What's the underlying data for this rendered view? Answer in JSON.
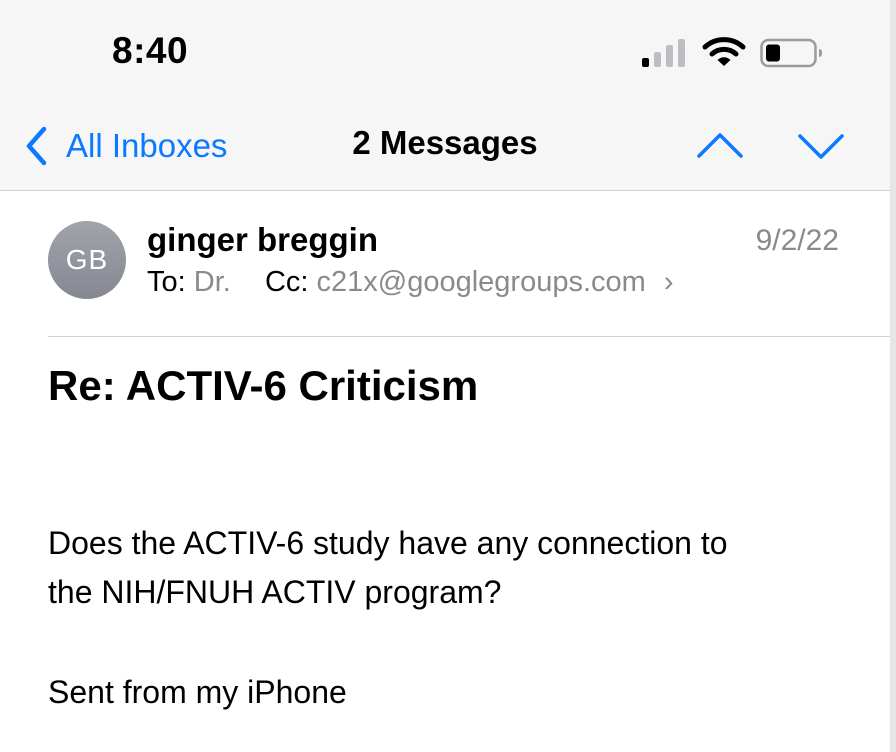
{
  "status_bar": {
    "time": "8:40"
  },
  "nav": {
    "back_label": "All Inboxes",
    "title": "2 Messages"
  },
  "message": {
    "avatar_initials": "GB",
    "sender": "ginger breggin",
    "date": "9/2/22",
    "to_label": "To:",
    "to_value": "Dr.",
    "cc_label": "Cc:",
    "cc_value": "c21x@googlegroups.com",
    "subject": "Re: ACTIV-6 Criticism",
    "body": [
      "Does the ACTIV-6 study have any connection to",
      "the NIH/FNUH  ACTIV program?"
    ],
    "signature": "Sent from my iPhone"
  },
  "icons": [
    "back-chevron-icon",
    "up-arrow-icon",
    "down-arrow-icon",
    "cellular-signal-icon",
    "wifi-icon",
    "battery-icon",
    "chevron-right-icon"
  ],
  "colors": {
    "accent": "#0a7aff",
    "secondary_text": "#8a8a8e",
    "avatar": "#8e9198"
  }
}
